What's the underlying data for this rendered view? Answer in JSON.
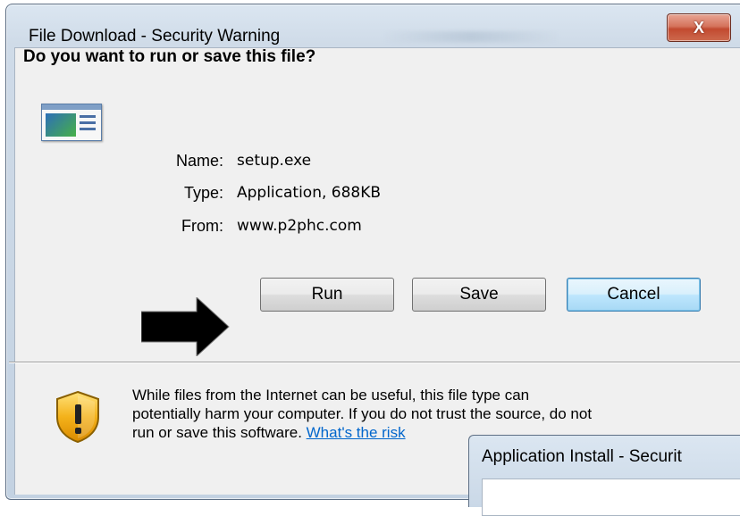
{
  "window": {
    "title": "File Download - Security Warning",
    "close_label": "X"
  },
  "question": "Do you want to run or save this file?",
  "file": {
    "icon": "application-window-icon",
    "name_label": "Name:",
    "name_value": "setup.exe",
    "type_label": "Type:",
    "type_value": "Application, 688KB",
    "from_label": "From:",
    "from_value": "www.p2phc.com"
  },
  "buttons": {
    "run": "Run",
    "save": "Save",
    "cancel": "Cancel"
  },
  "annotation": {
    "icon": "arrow-right-icon",
    "color": "#000000"
  },
  "warning": {
    "icon": "shield-warning-icon",
    "line1": "While files from the Internet can be useful, this file type can",
    "line2": "potentially harm your computer. If you do not trust the source, do not",
    "line3_prefix": "run or save this software. ",
    "risk_link": "What's the risk"
  },
  "overlay_dialog": {
    "title": "Application Install - Securit"
  },
  "colors": {
    "link": "#0066cc",
    "close_button": "#c24a30",
    "default_button_border": "#3c7fb1",
    "dialog_background": "#f0f0f0"
  }
}
